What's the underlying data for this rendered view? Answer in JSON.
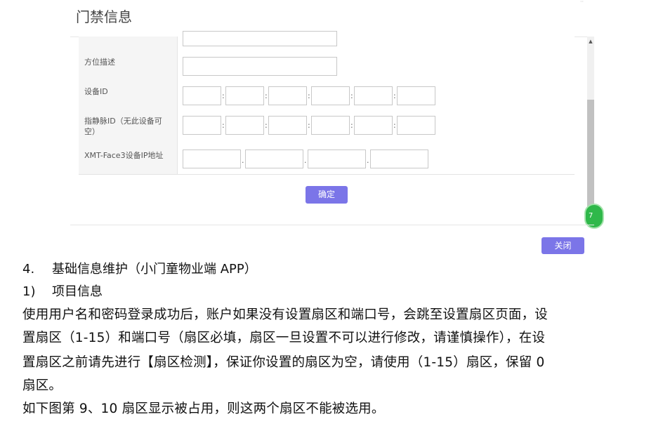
{
  "dialog": {
    "title": "门禁信息",
    "rows": [
      {
        "label": "方位描述"
      },
      {
        "label": "设备ID",
        "separators": [
          ":",
          ":",
          ":",
          ":",
          ":"
        ]
      },
      {
        "label": "指静脉ID（无此设备可空）",
        "separators": [
          ":",
          ":",
          ":",
          ":",
          ":"
        ]
      },
      {
        "label": "XMT-Face3设备IP地址",
        "separators": [
          ".",
          ".",
          "."
        ]
      }
    ],
    "confirm_label": "确定",
    "close_label": "关闭",
    "badge_text": "7"
  },
  "document": {
    "section_number": "4.",
    "section_title": "基础信息维护（小门童物业端 APP）",
    "subsection_number": "1)",
    "subsection_title": "项目信息",
    "paragraph_lines": [
      "使用用户名和密码登录成功后，账户如果没有设置扇区和端口号，会跳至设置扇区页面，设",
      "置扇区（1-15）和端口号（扇区必填，扇区一旦设置不可以进行修改，请谨慎操作），在设",
      "置扇区之前请先进行【扇区检测】，保证你设置的扇区为空，请使用（1-15）扇区，保留 0",
      "扇区。",
      "如下图第 9、10 扇区显示被占用，则这两个扇区不能被选用。"
    ]
  }
}
